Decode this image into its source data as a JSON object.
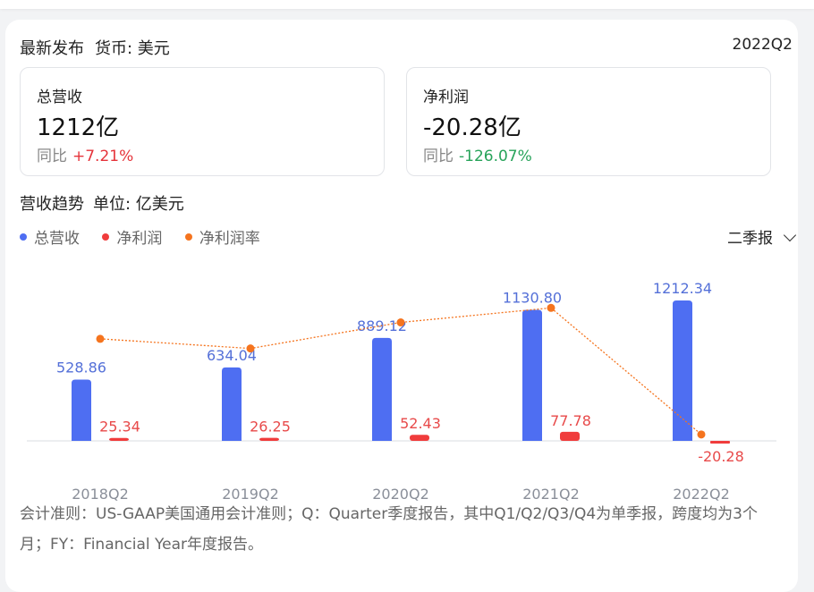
{
  "header": {
    "title": "最新发布",
    "currency": "货币: 美元",
    "period": "2022Q2"
  },
  "kpis": {
    "revenue": {
      "label": "总营收",
      "value": "1212亿",
      "yoy_label": "同比",
      "yoy": "+7.21%"
    },
    "net_profit": {
      "label": "净利润",
      "value": "-20.28亿",
      "yoy_label": "同比",
      "yoy": "-126.07%"
    }
  },
  "trend": {
    "title": "营收趋势",
    "unit": "单位: 亿美元"
  },
  "legend": [
    {
      "label": "总营收",
      "color": "#4e6ef2"
    },
    {
      "label": "净利润",
      "color": "#f03c3c"
    },
    {
      "label": "净利润率",
      "color": "#f5741e"
    }
  ],
  "period_selector": "二季报",
  "chart_data": {
    "type": "bar",
    "categories": [
      "2018Q2",
      "2019Q2",
      "2020Q2",
      "2021Q2",
      "2022Q2"
    ],
    "series": [
      {
        "name": "总营收",
        "values": [
          528.86,
          634.04,
          889.12,
          1130.8,
          1212.34
        ],
        "labels": [
          "528.86",
          "634.04",
          "889.12",
          "1130.80",
          "1212.34"
        ],
        "color": "#4e6ef2"
      },
      {
        "name": "净利润",
        "values": [
          25.34,
          26.25,
          52.43,
          77.78,
          -20.28
        ],
        "labels": [
          "25.34",
          "26.25",
          "52.43",
          "77.78",
          "-20.28"
        ],
        "color": "#f03c3c"
      },
      {
        "name": "净利润率",
        "type": "line",
        "values": [
          4.79,
          4.14,
          5.9,
          6.88,
          -1.67
        ],
        "color": "#f5741e"
      }
    ],
    "ylim": [
      -50,
      1250
    ]
  },
  "footnote": "会计准则：US-GAAP美国通用会计准则；Q：Quarter季度报告，其中Q1/Q2/Q3/Q4为单季报，跨度均为3个月；FY：Financial Year年度报告。"
}
